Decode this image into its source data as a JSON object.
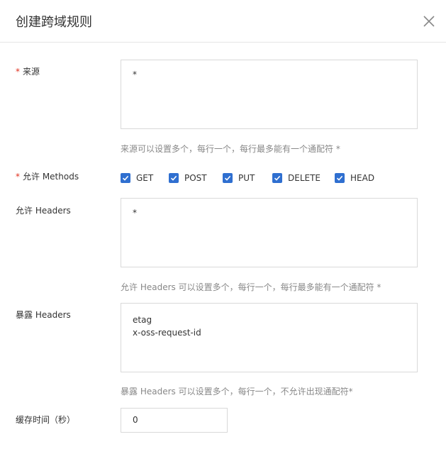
{
  "dialog": {
    "title": "创建跨域规则",
    "close_icon": "close-icon"
  },
  "origin": {
    "required_mark": "*",
    "label": "来源",
    "value": "*",
    "help": "来源可以设置多个，每行一个，每行最多能有一个通配符 *"
  },
  "methods": {
    "required_mark": "*",
    "label": "允许 Methods",
    "items": [
      {
        "label": "GET",
        "checked": true
      },
      {
        "label": "POST",
        "checked": true
      },
      {
        "label": "PUT",
        "checked": true
      },
      {
        "label": "DELETE",
        "checked": true
      },
      {
        "label": "HEAD",
        "checked": true
      }
    ],
    "checkbox_color": "#2f6fd0"
  },
  "allow_headers": {
    "label": "允许 Headers",
    "value": "*",
    "help": "允许 Headers 可以设置多个，每行一个，每行最多能有一个通配符 *"
  },
  "expose_headers": {
    "label": "暴露 Headers",
    "value": "etag\nx-oss-request-id",
    "help": "暴露 Headers 可以设置多个，每行一个，不允许出现通配符*"
  },
  "cache_time": {
    "label": "缓存时间（秒）",
    "value": "0"
  }
}
